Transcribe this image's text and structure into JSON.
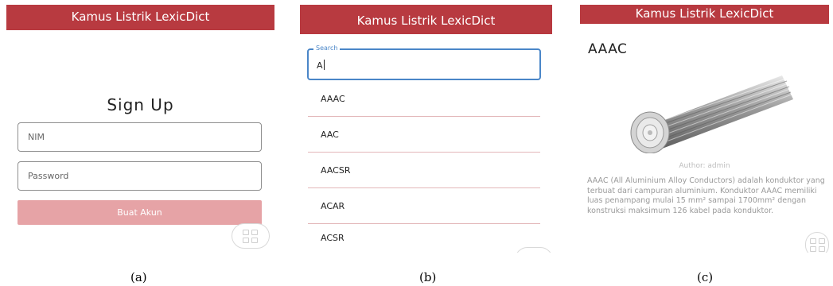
{
  "panels": [
    {
      "app_title": "Kamus Listrik LexicDict",
      "heading": "Sign Up",
      "fields": {
        "nim_placeholder": "NIM",
        "password_placeholder": "Password"
      },
      "button_label": "Buat Akun",
      "floating_icon": "grid-icon",
      "caption": "(a)"
    },
    {
      "app_title": "Kamus Listrik LexicDict",
      "search": {
        "label": "Search",
        "value": "A"
      },
      "items": [
        "AAAC",
        "AAC",
        "AACSR",
        "ACAR",
        "ACSR"
      ],
      "floating_icon": "grid-icon",
      "caption": "(b)"
    },
    {
      "app_title": "Kamus Listrik LexicDict",
      "term": "AAAC",
      "image": "aluminium-cable-image",
      "author": "Author: admin",
      "description": "AAAC (All Aluminium Alloy Conductors) adalah konduktor yang terbuat dari campuran aluminium. Konduktor AAAC memiliki luas penampang mulai 15 mm² sampai 1700mm² dengan konstruksi maksimum 126 kabel pada konduktor.",
      "floating_icon": "grid-icon",
      "caption": "(c)"
    }
  ],
  "colors": {
    "appbar": "#b83a40",
    "button": "#e6a3a6",
    "search_focus": "#4a86c8",
    "divider": "#e3b7b9"
  }
}
